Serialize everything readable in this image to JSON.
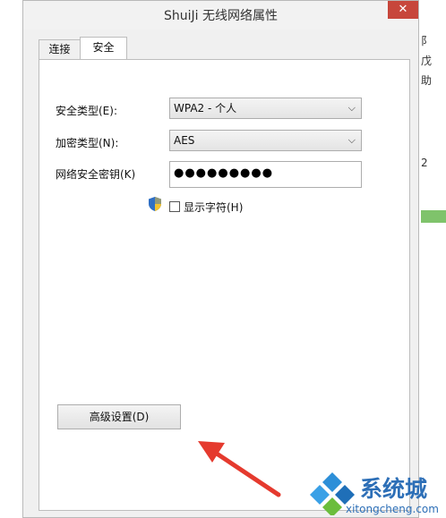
{
  "window": {
    "title": "ShuiJi 无线网络属性",
    "close_label": "✕"
  },
  "tabs": [
    {
      "label": "连接",
      "selected": false
    },
    {
      "label": "安全",
      "selected": true
    }
  ],
  "security_type": {
    "label": "安全类型(E):",
    "value": "WPA2 - 个人"
  },
  "encryption_type": {
    "label": "加密类型(N):",
    "value": "AES"
  },
  "network_key": {
    "label": "网络安全密钥(K)",
    "value": "●●●●●●●●●"
  },
  "show_chars": {
    "label": "显示字符(H)",
    "checked": false
  },
  "advanced_button": {
    "label": "高级设置(D)"
  },
  "background_window": {
    "chars": [
      "阝",
      "戊",
      "助",
      "2"
    ]
  },
  "watermark": {
    "brand": "系统城",
    "url": "xitongcheng.com"
  },
  "colors": {
    "close": "#c7463b",
    "arrow": "#e53a2e",
    "logo": "#2d6fb7"
  }
}
